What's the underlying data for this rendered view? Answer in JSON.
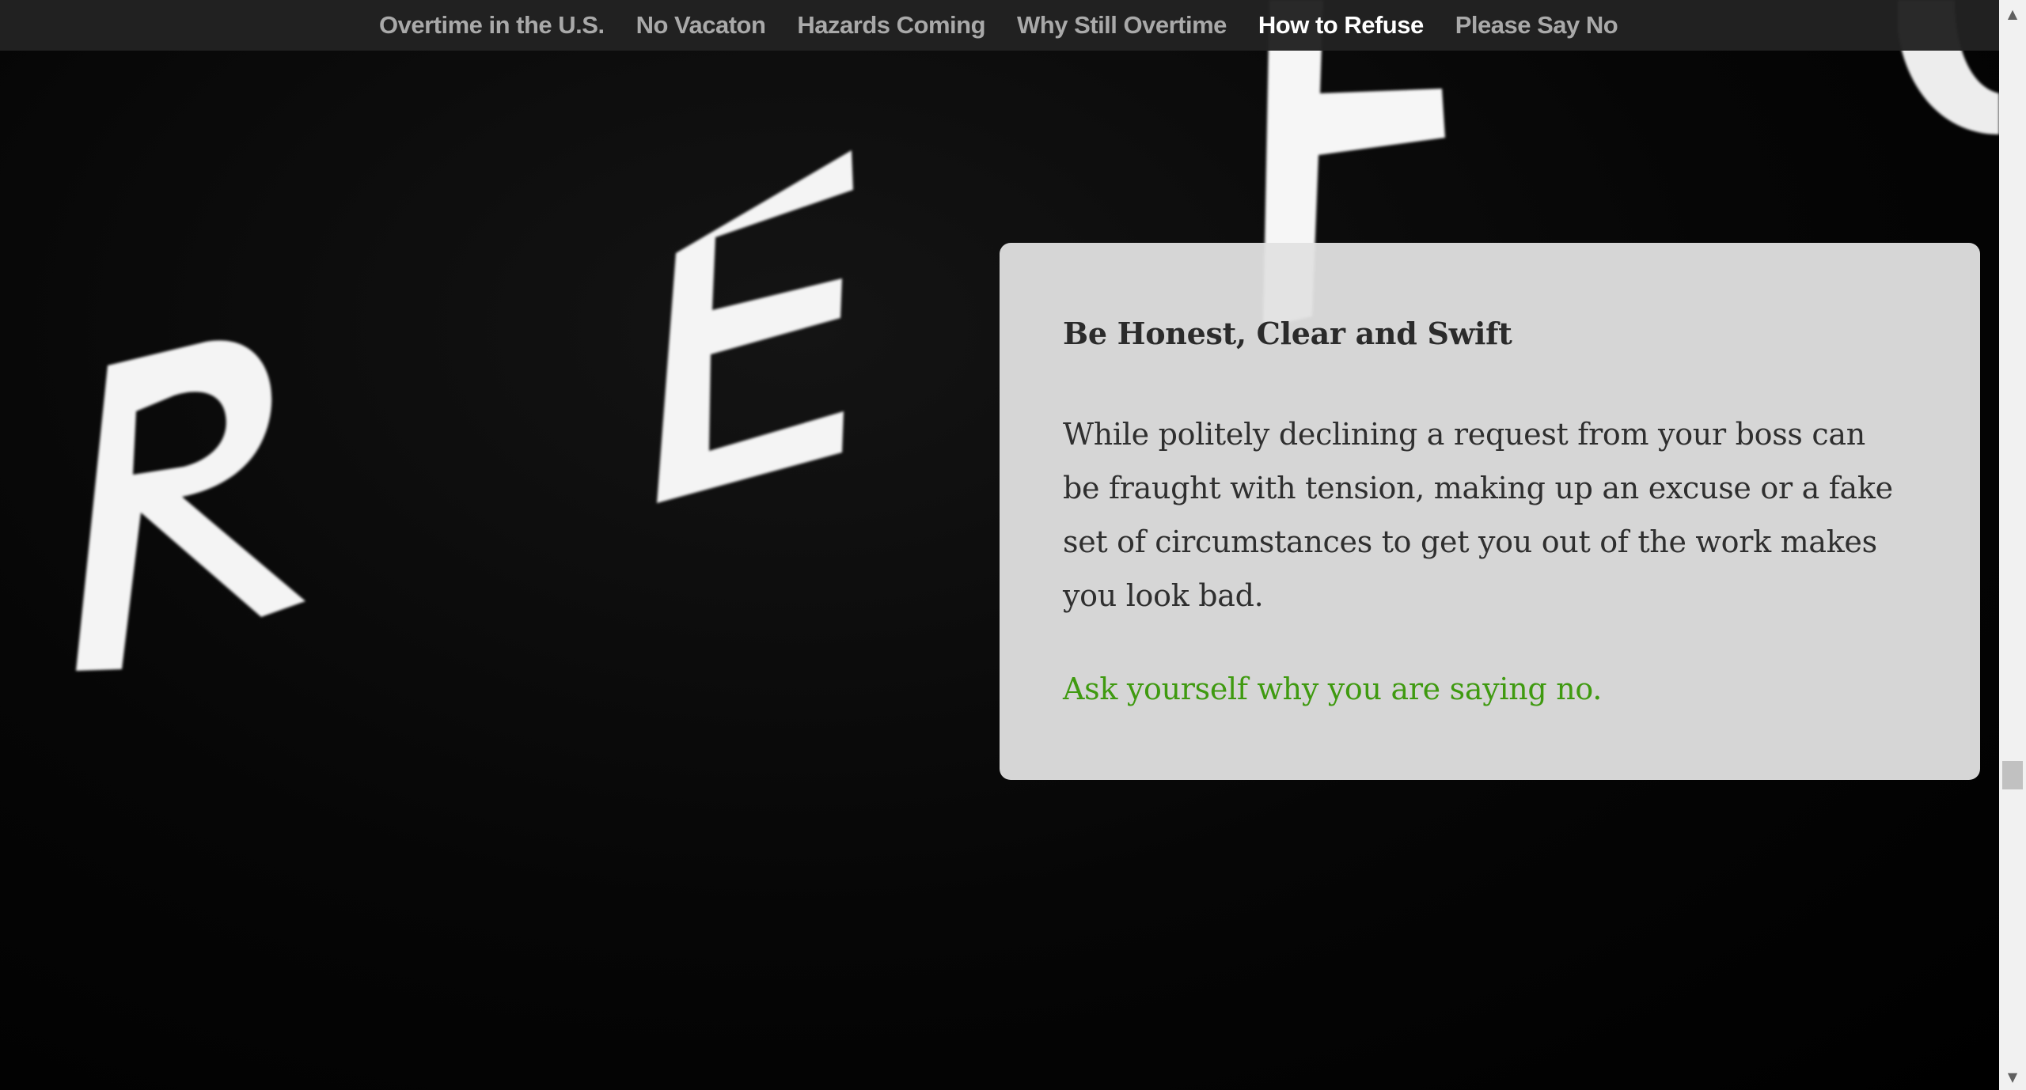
{
  "nav": {
    "items": [
      {
        "label": "Overtime in the U.S.",
        "active": false
      },
      {
        "label": "No Vacaton",
        "active": false
      },
      {
        "label": "Hazards Coming",
        "active": false
      },
      {
        "label": "Why Still Overtime",
        "active": false
      },
      {
        "label": "How to Refuse",
        "active": true
      },
      {
        "label": "Please Say No",
        "active": false
      }
    ]
  },
  "card": {
    "heading": "Be Honest, Clear and Swift",
    "body": "While politely declining a request from your boss can be fraught with tension, making up an excuse or a fake set of circumstances to get you out of the work makes you look bad.",
    "highlight": "Ask yourself why you are saying no."
  },
  "background": {
    "letters": [
      "R",
      "E",
      "F",
      "U"
    ]
  },
  "scrollbar": {
    "up_icon": "triangle-up-icon",
    "down_icon": "triangle-down-icon"
  },
  "colors": {
    "nav_bg": "#222222",
    "nav_text": "#a9a9a9",
    "nav_active": "#ffffff",
    "card_bg": "#e2e2e2",
    "heading": "#2b2b2b",
    "highlight": "#3f9a10"
  }
}
